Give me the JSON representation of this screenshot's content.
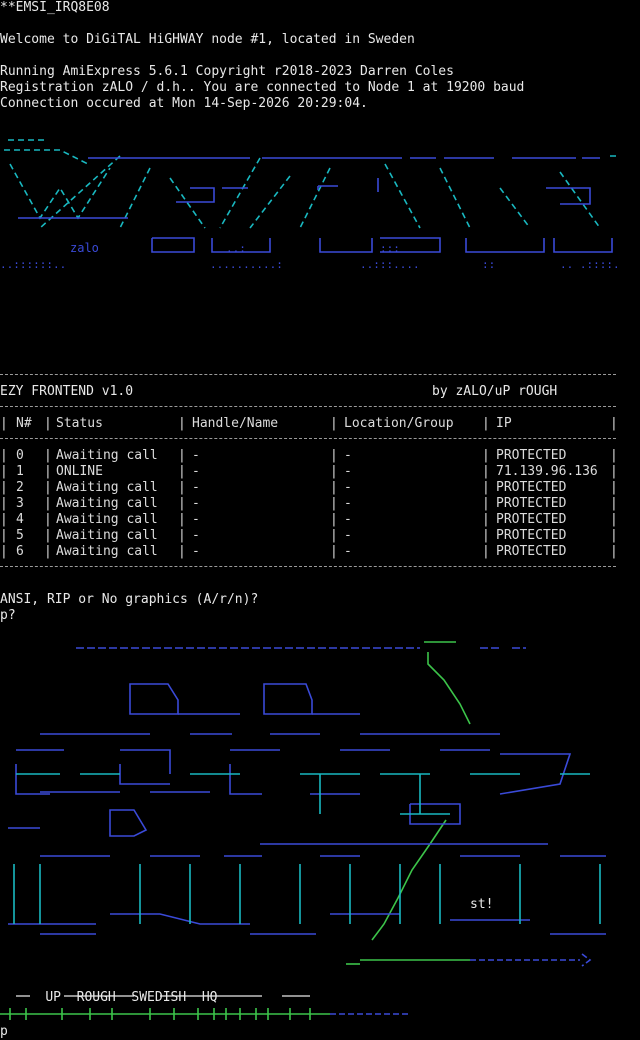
{
  "header": {
    "emsi": "**EMSI_IRQ8E08",
    "welcome": "Welcome to DiGiTAL HiGHWAY node #1, located in Sweden",
    "running": "Running AmiExpress 5.6.1 Copyright r2018-2023 Darren Coles",
    "registration": "Registration zALO / d.h.. You are connected to Node 1 at 19200 baud",
    "connection": "Connection occured at Mon 14-Sep-2026 20:29:04."
  },
  "logo_tag": "zalo",
  "frontend": {
    "title": "EZY FRONTEND v1.0",
    "credit": "by zALO/uP rOUGH",
    "columns": [
      "N#",
      "Status",
      "Handle/Name",
      "Location/Group",
      "IP"
    ],
    "rows": [
      {
        "n": "0",
        "status": "Awaiting call",
        "handle": "-",
        "location": "-",
        "ip": "PROTECTED"
      },
      {
        "n": "1",
        "status": "ONLINE",
        "handle": "-",
        "location": "-",
        "ip": "71.139.96.136"
      },
      {
        "n": "2",
        "status": "Awaiting call",
        "handle": "-",
        "location": "-",
        "ip": "PROTECTED"
      },
      {
        "n": "3",
        "status": "Awaiting call",
        "handle": "-",
        "location": "-",
        "ip": "PROTECTED"
      },
      {
        "n": "4",
        "status": "Awaiting call",
        "handle": "-",
        "location": "-",
        "ip": "PROTECTED"
      },
      {
        "n": "5",
        "status": "Awaiting call",
        "handle": "-",
        "location": "-",
        "ip": "PROTECTED"
      },
      {
        "n": "6",
        "status": "Awaiting call",
        "handle": "-",
        "location": "-",
        "ip": "PROTECTED"
      }
    ]
  },
  "prompt": {
    "question": "ANSI, RIP or No graphics (A/r/n)?",
    "answer": "p?"
  },
  "art2": {
    "tag": "st!",
    "tagline": "UP  ROUGH  SWEDISH  HQ"
  },
  "input_line": "p",
  "colors": {
    "background": "#000000",
    "text": "#c8c8c8",
    "blue": "#3a4ad8",
    "cyan": "#19b8c0",
    "green": "#3cc44a"
  }
}
